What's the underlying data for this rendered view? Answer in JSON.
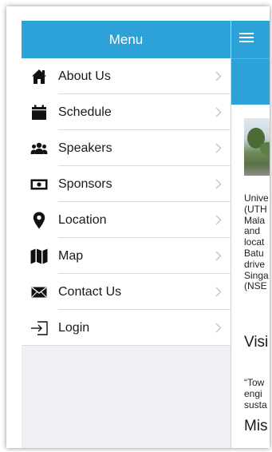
{
  "drawer": {
    "title": "Menu",
    "items": [
      {
        "label": "About Us",
        "icon": "home-icon"
      },
      {
        "label": "Schedule",
        "icon": "calendar-icon"
      },
      {
        "label": "Speakers",
        "icon": "people-icon"
      },
      {
        "label": "Sponsors",
        "icon": "money-icon"
      },
      {
        "label": "Location",
        "icon": "map-pin-icon"
      },
      {
        "label": "Map",
        "icon": "map-icon"
      },
      {
        "label": "Contact Us",
        "icon": "envelope-icon"
      },
      {
        "label": "Login",
        "icon": "login-icon"
      }
    ]
  },
  "page": {
    "body_lines": [
      "Unive",
      "(UTH",
      "Mala",
      "and",
      "locat",
      "Batu",
      "drive",
      "Singa",
      "(NSE"
    ],
    "vision_heading": "Visi",
    "quote_lines": [
      "“Tow",
      "engi",
      "susta"
    ],
    "mission_heading": "Mis"
  },
  "colors": {
    "accent": "#2ca2d8",
    "drawer_bg": "#efeff4"
  }
}
